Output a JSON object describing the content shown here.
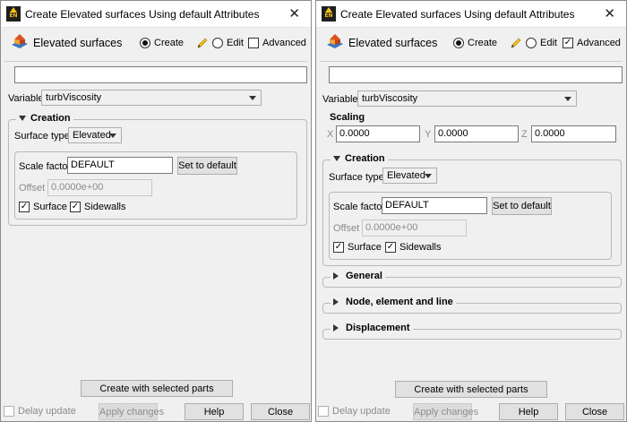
{
  "window_title": "Create Elevated surfaces Using default Attributes",
  "app_icon_text": "EN",
  "feature_label": "Elevated surfaces",
  "modes": {
    "create": "Create",
    "edit": "Edit",
    "advanced": "Advanced"
  },
  "variable": {
    "label": "Variable",
    "value": "turbViscosity"
  },
  "creation": {
    "title": "Creation",
    "surface_type_label": "Surface type",
    "surface_type_value": "Elevated",
    "scale_factor_label": "Scale factor",
    "scale_factor_value": "DEFAULT",
    "set_default_button": "Set to default",
    "offset_label": "Offset",
    "offset_value": "0.0000e+00",
    "surface_label": "Surface",
    "sidewalls_label": "Sidewalls"
  },
  "scaling": {
    "title": "Scaling",
    "x_label": "X",
    "x_value": "0.0000",
    "y_label": "Y",
    "y_value": "0.0000",
    "z_label": "Z",
    "z_value": "0.0000"
  },
  "sections": {
    "general": "General",
    "node_element_line": "Node, element and line",
    "displacement": "Displacement"
  },
  "footer": {
    "create_button": "Create with selected parts",
    "delay_update": "Delay update",
    "apply_button": "Apply changes",
    "help_button": "Help",
    "close_button": "Close"
  },
  "left_window": {
    "advanced_checked": false
  },
  "right_window": {
    "advanced_checked": true
  },
  "colors": {
    "window_bg": "#f0f0f0",
    "title_bg": "#ffffff",
    "icon_yellow": "#f2c21a"
  }
}
